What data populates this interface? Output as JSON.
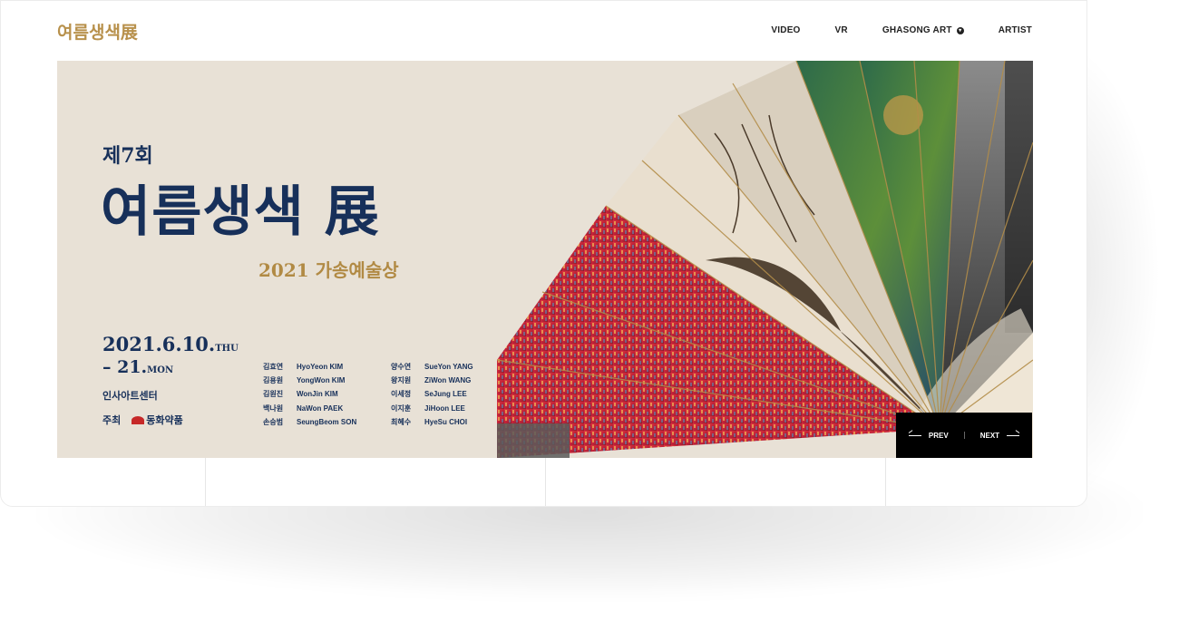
{
  "header": {
    "logo": "여름생색展",
    "nav": [
      {
        "label": "VIDEO"
      },
      {
        "label": "VR"
      },
      {
        "label": "GHASONG ART"
      },
      {
        "label": "ARTIST"
      }
    ]
  },
  "banner": {
    "edition": "제7회",
    "title": "여름생색 展",
    "subtitle": "2021 가송예술상",
    "date_start": "2021.6.10.",
    "date_start_day": "THU",
    "date_end": "–  21.",
    "date_end_day": "MON",
    "venue": "인사아트센터",
    "host_label": "주최",
    "host_name": "동화약품",
    "artists_col1": [
      {
        "ko": "김효연",
        "en": "HyoYeon KIM"
      },
      {
        "ko": "김용원",
        "en": "YongWon KIM"
      },
      {
        "ko": "김원진",
        "en": "WonJin KIM"
      },
      {
        "ko": "백나원",
        "en": "NaWon PAEK"
      },
      {
        "ko": "손승범",
        "en": "SeungBeom SON"
      }
    ],
    "artists_col2": [
      {
        "ko": "양수연",
        "en": "SueYon YANG"
      },
      {
        "ko": "왕지원",
        "en": "ZiWon WANG"
      },
      {
        "ko": "이세정",
        "en": "SeJung LEE"
      },
      {
        "ko": "이지훈",
        "en": "JiHoon LEE"
      },
      {
        "ko": "최혜수",
        "en": "HyeSu CHOI"
      }
    ]
  },
  "slider": {
    "prev_label": "PREV",
    "next_label": "NEXT"
  }
}
